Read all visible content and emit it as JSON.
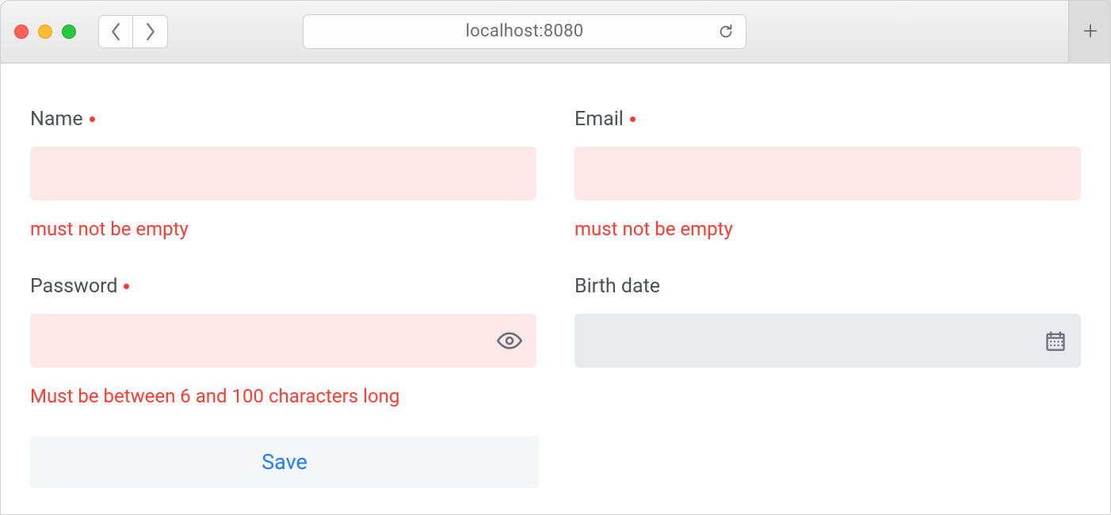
{
  "browser": {
    "address": "localhost:8080"
  },
  "form": {
    "name": {
      "label": "Name",
      "required": true,
      "value": "",
      "error": "must not be empty"
    },
    "email": {
      "label": "Email",
      "required": true,
      "value": "",
      "error": "must not be empty"
    },
    "password": {
      "label": "Password",
      "required": true,
      "value": "",
      "error": "Must be between 6 and 100 characters long"
    },
    "birthdate": {
      "label": "Birth date",
      "required": false,
      "value": ""
    },
    "save_label": "Save"
  },
  "colors": {
    "error": "#ff3b30",
    "error_bg": "#fde7e7",
    "neutral_bg": "#e7ebee",
    "label": "#4a4f58",
    "link": "#1f7cff"
  }
}
